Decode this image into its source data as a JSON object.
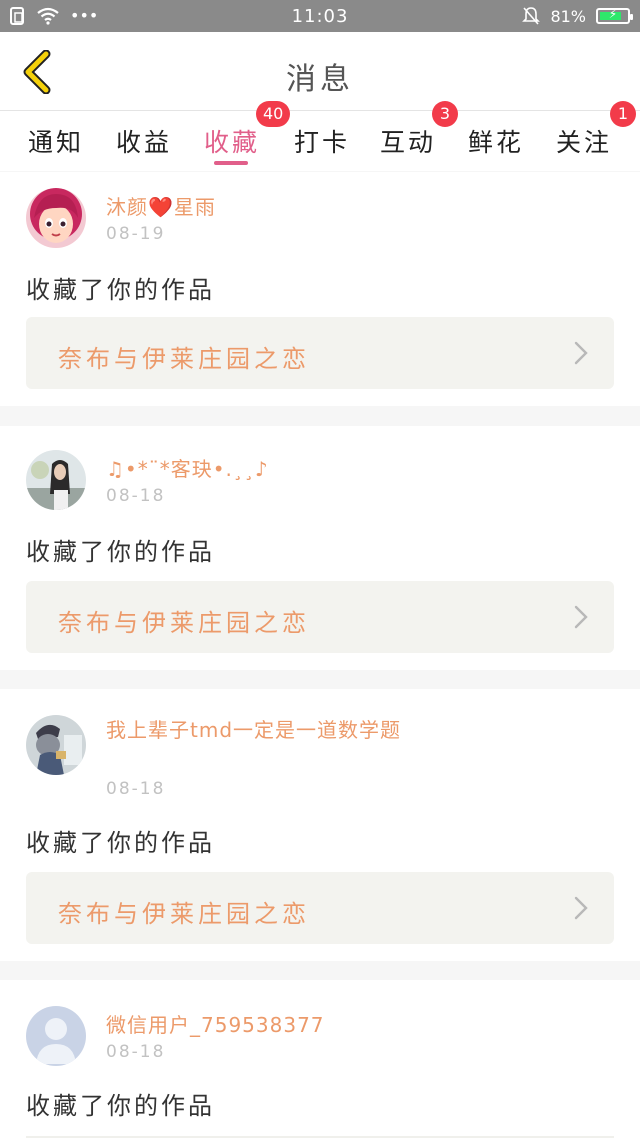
{
  "status_bar": {
    "time": "11:03",
    "battery_text": "81%",
    "battery_level": 0.81,
    "left_icons": [
      "sim-icon",
      "wifi-icon",
      "more-dots-icon"
    ],
    "right_icons": [
      "mute-bell-icon",
      "battery-charging-icon"
    ],
    "more_dots": "•••",
    "bolt": "⚡"
  },
  "header": {
    "title": "消息",
    "back_icon": "back-chevron-icon"
  },
  "tabs": [
    {
      "label": "通知",
      "badge": ""
    },
    {
      "label": "收益",
      "badge": ""
    },
    {
      "label": "收藏",
      "badge": "40",
      "active": true
    },
    {
      "label": "打卡",
      "badge": ""
    },
    {
      "label": "互动",
      "badge": "3"
    },
    {
      "label": "鲜花",
      "badge": ""
    },
    {
      "label": "关注",
      "badge": "1"
    }
  ],
  "messages": [
    {
      "user": "沐颜❤️星雨",
      "date": "08-19",
      "action": "收藏了你的作品",
      "work": "奈布与伊莱庄园之恋"
    },
    {
      "user": "♫•*¨*客玦•.¸¸♪",
      "date": "08-18",
      "action": "收藏了你的作品",
      "work": "奈布与伊莱庄园之恋"
    },
    {
      "user": "我上辈子tmd一定是一道数学题",
      "date": "08-18",
      "action": "收藏了你的作品",
      "work": "奈布与伊莱庄园之恋"
    },
    {
      "user": "微信用户_759538377",
      "date": "08-18",
      "action": "收藏了你的作品",
      "work": ""
    }
  ],
  "colors": {
    "accent": "#e15f8a",
    "username": "#ec9a6a",
    "badge": "#f23b4a",
    "back_arrow": "#f5d10a"
  }
}
